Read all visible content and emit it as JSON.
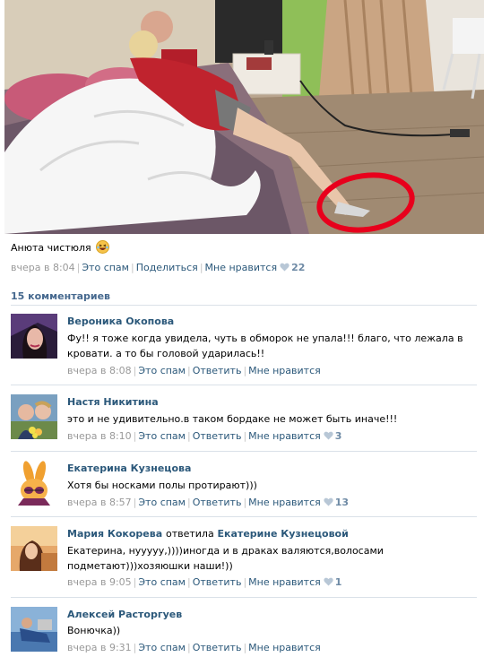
{
  "post": {
    "text": "Анюта чистюля",
    "emoji": "laughing-face-icon",
    "time": "вчера в 8:04",
    "spam": "Это спам",
    "share": "Поделиться",
    "like": "Мне нравится",
    "like_count": "22"
  },
  "comments_count": "15 комментариев",
  "comments": [
    {
      "author": "Вероника Окопова",
      "text": "Фу!! я тоже когда увидела, чуть в обморок не упала!!! благо, что лежала в кровати. а то бы головой ударилась!!",
      "time": "вчера в 8:08",
      "spam": "Это спам",
      "reply": "Ответить",
      "like": "Мне нравится",
      "like_count": ""
    },
    {
      "author": "Настя Никитина",
      "text": "это и не удивительно.в таком бордаке не может быть иначе!!!",
      "time": "вчера в 8:10",
      "spam": "Это спам",
      "reply": "Ответить",
      "like": "Мне нравится",
      "like_count": "3"
    },
    {
      "author": "Екатерина Кузнецова",
      "text": "Хотя бы носками полы протирают)))",
      "time": "вчера в 8:57",
      "spam": "Это спам",
      "reply": "Ответить",
      "like": "Мне нравится",
      "like_count": "13"
    },
    {
      "author": "Мария Кокорева",
      "reply_word": "ответила",
      "reply_to": "Екатерине Кузнецовой",
      "text": "Екатерина, нууууу,))))иногда и в драках валяются,волосами подметают)))хозяюшки наши!))",
      "time": "вчера в 9:05",
      "spam": "Это спам",
      "reply": "Ответить",
      "like": "Мне нравится",
      "like_count": "1"
    },
    {
      "author": "Алексей Расторгуев",
      "text": "Вонючка))",
      "time": "вчера в 9:31",
      "spam": "Это спам",
      "reply": "Ответить",
      "like": "Мне нравится",
      "like_count": ""
    }
  ],
  "colors": {
    "link": "#2b587a",
    "meta_gray": "#999999",
    "heading_blue": "#45688e",
    "highlight_circle": "#e8001c"
  }
}
